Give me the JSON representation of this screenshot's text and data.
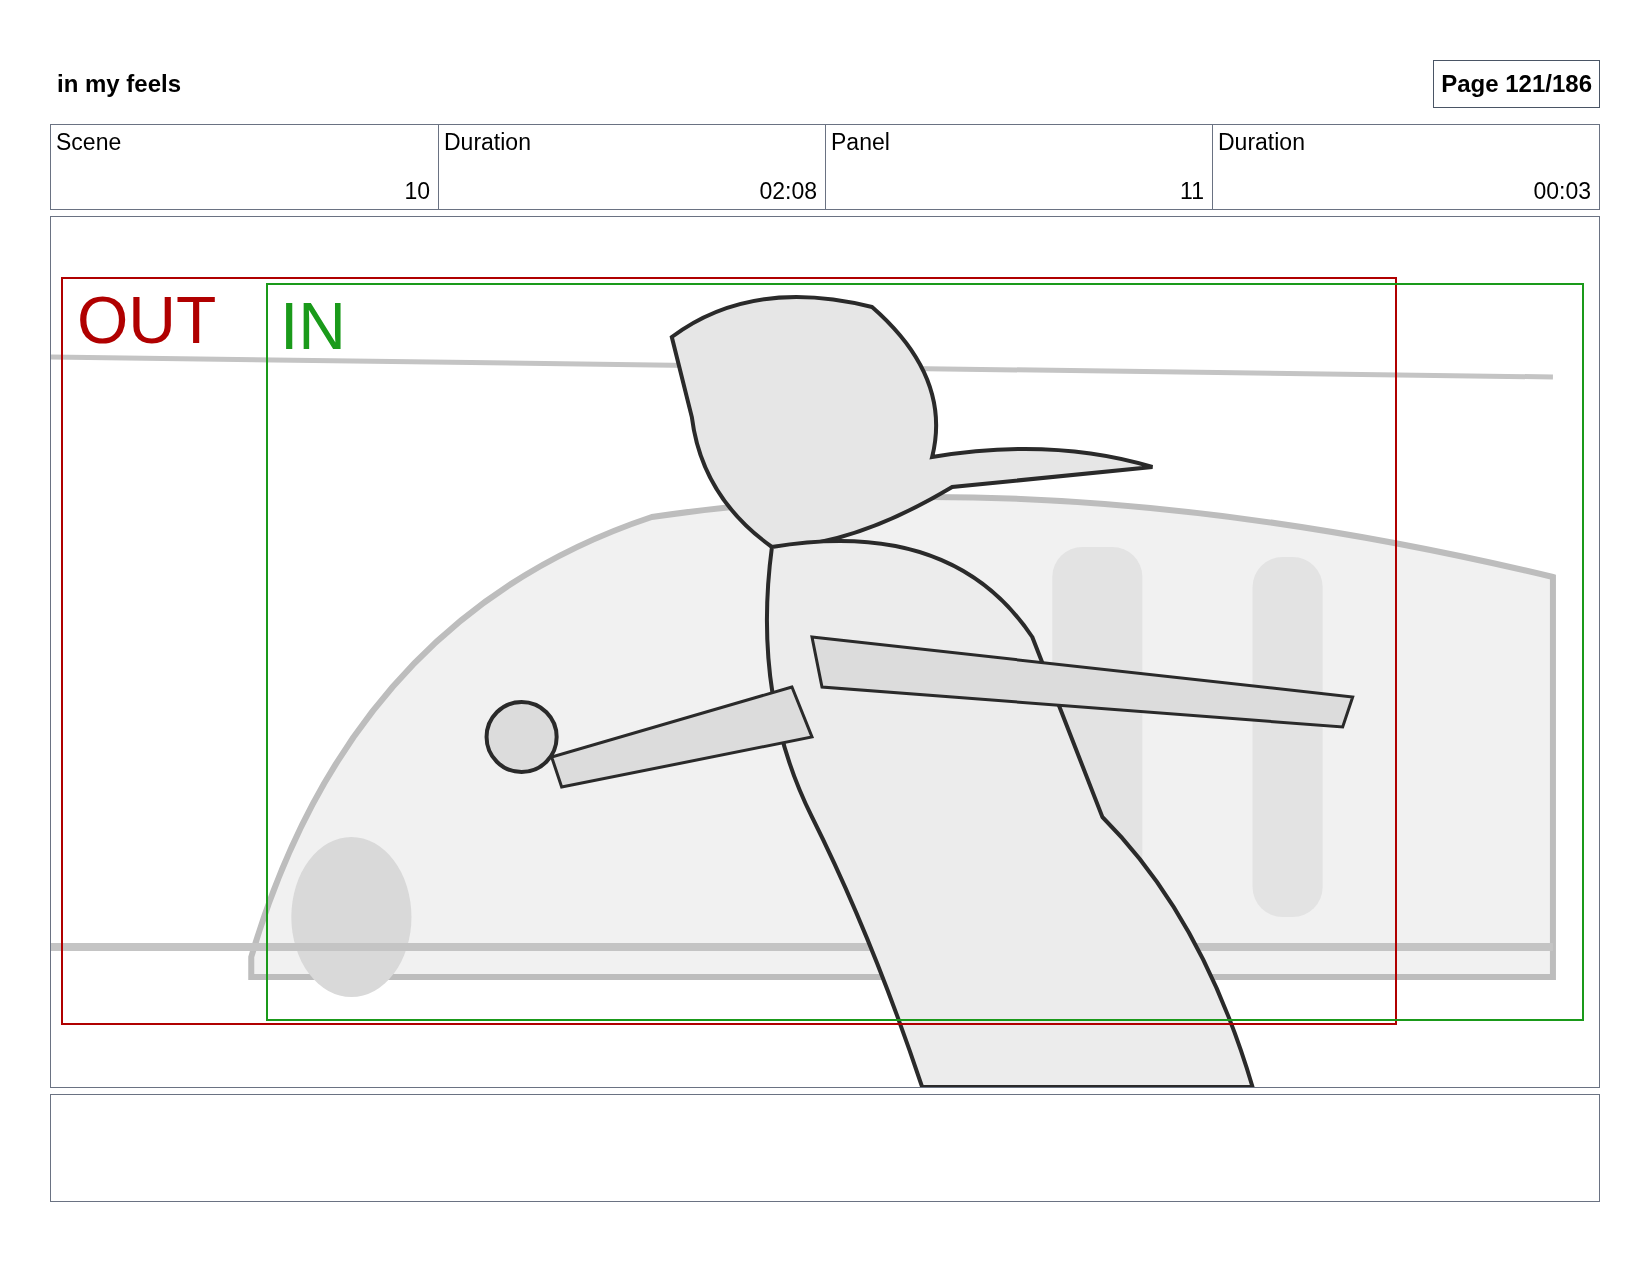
{
  "title": "in my feels",
  "page": "Page 121/186",
  "info_table": {
    "headers": [
      "Scene",
      "Duration",
      "Panel",
      "Duration"
    ],
    "values": [
      "10",
      "02:08",
      "11",
      "00:03"
    ]
  },
  "panel": {
    "frames": [
      {
        "label": "OUT",
        "color": "#b00000"
      },
      {
        "label": "IN",
        "color": "#1a9a1a"
      }
    ]
  }
}
